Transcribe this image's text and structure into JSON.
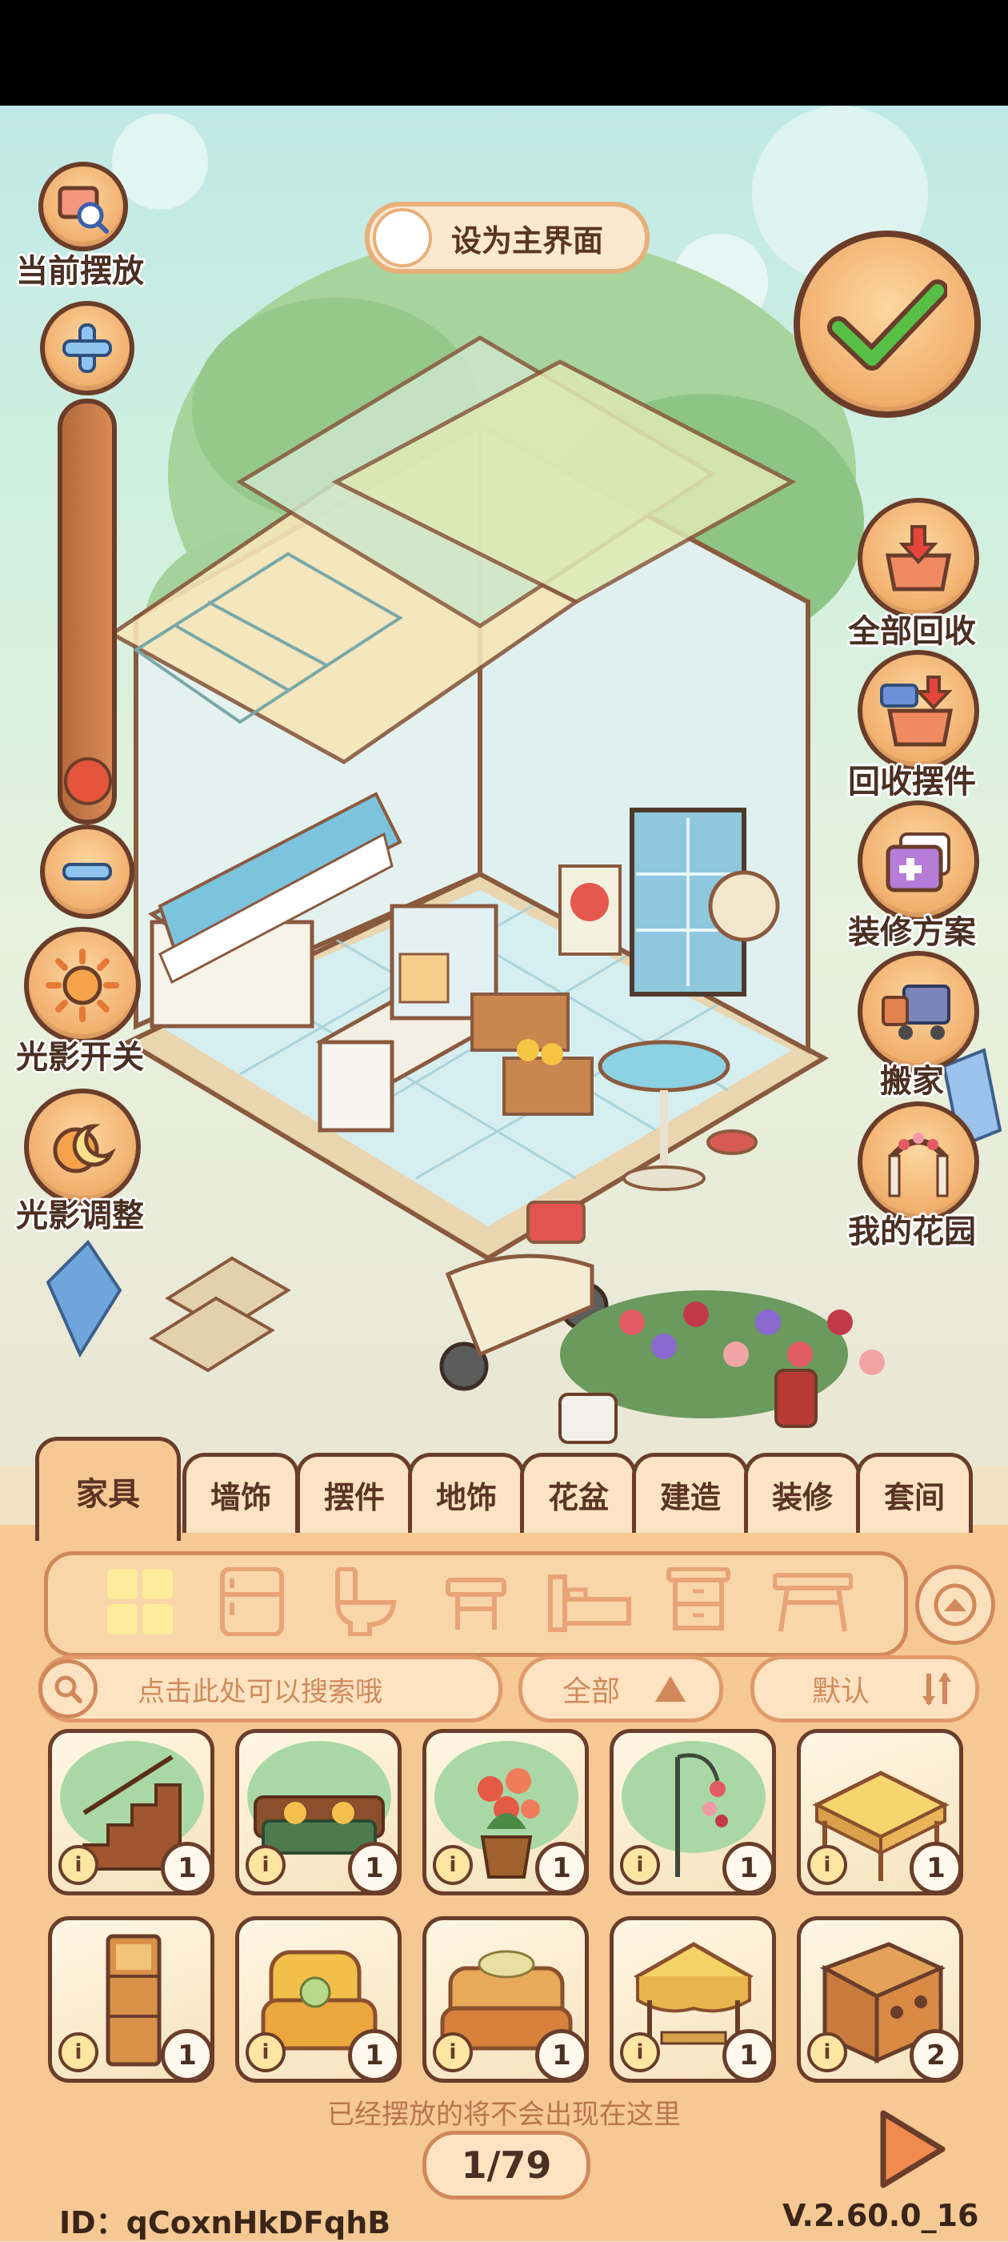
{
  "top": {
    "set_main_label": "设为主界面",
    "current_placement_label": "当前摆放"
  },
  "left_controls": {
    "light_toggle_label": "光影开关",
    "light_adjust_label": "光影调整",
    "zoom_level": 0.97
  },
  "right_controls": {
    "recycle_all_label": "全部回收",
    "recycle_ornaments_label": "回收摆件",
    "renovation_plan_label": "装修方案",
    "move_house_label": "搬家",
    "my_garden_label": "我的花园"
  },
  "tabs": [
    {
      "label": "家具",
      "active": true
    },
    {
      "label": "墙饰",
      "active": false
    },
    {
      "label": "摆件",
      "active": false
    },
    {
      "label": "地饰",
      "active": false
    },
    {
      "label": "花盆",
      "active": false
    },
    {
      "label": "建造",
      "active": false
    },
    {
      "label": "装修",
      "active": false
    },
    {
      "label": "套间",
      "active": false
    }
  ],
  "categories": [
    "all-grid-icon",
    "fridge-icon",
    "toilet-icon",
    "stool-icon",
    "bed-icon",
    "cabinet-icon",
    "table-icon"
  ],
  "search": {
    "placeholder": "点击此处可以搜索哦"
  },
  "filter": {
    "label": "全部"
  },
  "sort": {
    "label": "默认"
  },
  "items": [
    {
      "name": "wooden-staircase",
      "count": "1",
      "info": "i"
    },
    {
      "name": "green-sofa",
      "count": "1",
      "info": "i"
    },
    {
      "name": "rose-bucket",
      "count": "1",
      "info": "i"
    },
    {
      "name": "flower-lamp",
      "count": "1",
      "info": "i"
    },
    {
      "name": "yellow-table",
      "count": "1",
      "info": "i"
    },
    {
      "name": "tall-cabinet",
      "count": "1",
      "info": "i"
    },
    {
      "name": "yellow-armchair",
      "count": "1",
      "info": "i"
    },
    {
      "name": "orange-sofa",
      "count": "1",
      "info": "i"
    },
    {
      "name": "canopy-side-table",
      "count": "1",
      "info": "i"
    },
    {
      "name": "wooden-dresser",
      "count": "2",
      "info": "i"
    }
  ],
  "footer": {
    "hint": "已经摆放的将不会出现在这里",
    "page": "1/79",
    "id": "ID：qCoxnHkDFqhB",
    "version": "V.2.60.0_16"
  },
  "colors": {
    "brown": "#6a3d2a",
    "orange": "#f6c893",
    "green_check": "#3fae3a",
    "red": "#e65a43"
  }
}
